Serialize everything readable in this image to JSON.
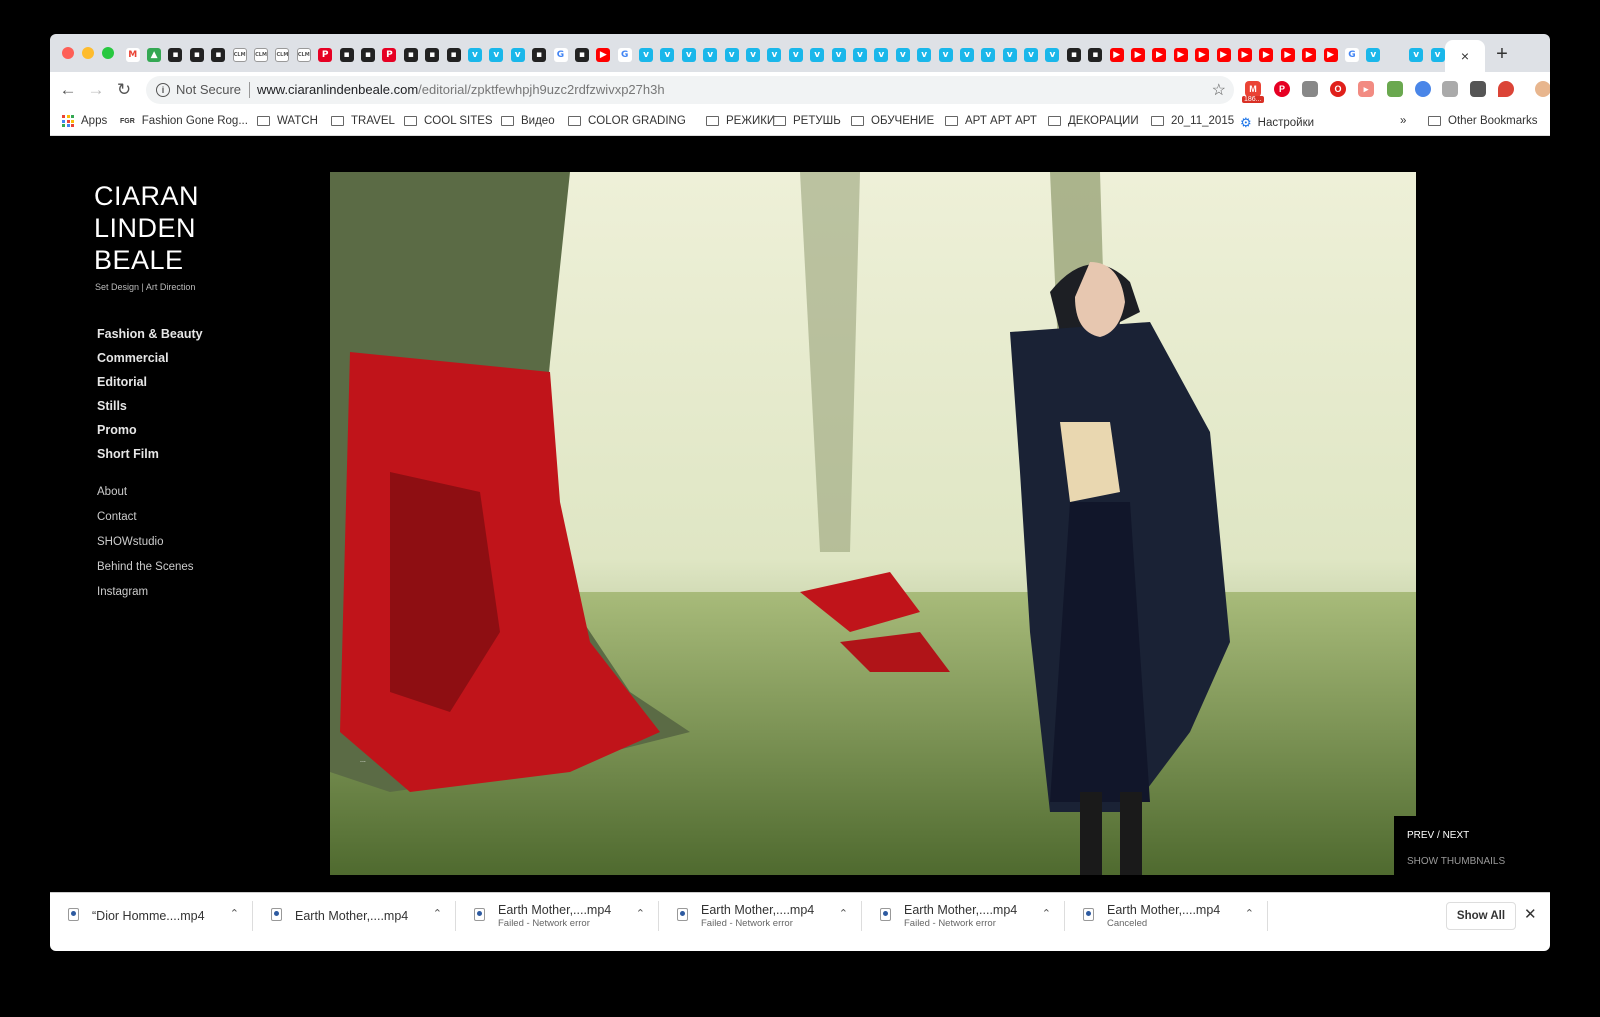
{
  "browser": {
    "tabs_favicons": [
      "gmail-icon",
      "drive-icon",
      "site-icon",
      "site-icon",
      "site-icon",
      "clm-icon",
      "clm-icon",
      "clm-icon",
      "clm-icon",
      "pinterest-icon",
      "site-icon",
      "site-icon",
      "pinterest-icon",
      "site-icon",
      "site-icon",
      "site-icon",
      "vimeo-icon",
      "vimeo-icon",
      "vimeo-icon",
      "site-icon",
      "google-icon",
      "site-icon",
      "youtube-icon",
      "google-icon",
      "vimeo-icon",
      "vimeo-icon",
      "vimeo-icon",
      "vimeo-icon",
      "vimeo-icon",
      "vimeo-icon",
      "vimeo-icon",
      "vimeo-icon",
      "vimeo-icon",
      "vimeo-icon",
      "vimeo-icon",
      "vimeo-icon",
      "vimeo-icon",
      "vimeo-icon",
      "vimeo-icon",
      "vimeo-icon",
      "vimeo-icon",
      "vimeo-icon",
      "vimeo-icon",
      "vimeo-icon",
      "site-icon",
      "site-icon",
      "youtube-icon",
      "youtube-icon",
      "youtube-icon",
      "youtube-icon",
      "youtube-icon",
      "youtube-icon",
      "youtube-icon",
      "youtube-icon",
      "youtube-icon",
      "youtube-icon",
      "youtube-icon",
      "google-icon",
      "vimeo-icon",
      "blank",
      "vimeo-icon",
      "vimeo-icon"
    ],
    "tab_close": "×",
    "new_tab": "+",
    "security_label": "Not Secure",
    "url_host": "www.ciaranlindenbeale.com",
    "url_path": "/editorial/zpktfewhpjh9uzc2rdfzwivxp27h3h",
    "ext_badge": "186...",
    "bookmarks": [
      {
        "label": "Apps",
        "icon": "apps-icon"
      },
      {
        "label": "Fashion Gone Rog...",
        "icon": "fgr-icon"
      },
      {
        "label": "WATCH",
        "icon": "folder-icon"
      },
      {
        "label": "TRAVEL",
        "icon": "folder-icon"
      },
      {
        "label": "COOL SITES",
        "icon": "folder-icon"
      },
      {
        "label": "Видео",
        "icon": "folder-icon"
      },
      {
        "label": "COLOR GRADING",
        "icon": "folder-icon"
      },
      {
        "label": "РЕЖИКИ",
        "icon": "folder-icon"
      },
      {
        "label": "РЕТУШЬ",
        "icon": "folder-icon"
      },
      {
        "label": "ОБУЧЕНИЕ",
        "icon": "folder-icon"
      },
      {
        "label": "АРТ АРТ АРТ",
        "icon": "folder-icon"
      },
      {
        "label": "ДЕКОРАЦИИ",
        "icon": "folder-icon"
      },
      {
        "label": "20_11_2015",
        "icon": "folder-icon"
      },
      {
        "label": "Настройки",
        "icon": "gear-icon"
      }
    ],
    "bookmarks_overflow": "»",
    "other_bookmarks": "Other Bookmarks"
  },
  "site": {
    "logo_lines": [
      "CIARAN",
      "LINDEN",
      "BEALE"
    ],
    "tagline": "Set Design | Art Direction",
    "nav_primary": [
      "Fashion & Beauty",
      "Commercial",
      "Editorial",
      "Stills",
      "Promo",
      "Short Film"
    ],
    "nav_secondary": [
      "About",
      "Contact",
      "SHOWstudio",
      "Behind the Scenes",
      "Instagram"
    ],
    "prev_next": "PREV / NEXT",
    "show_thumbnails": "SHOW THUMBNAILS"
  },
  "downloads": [
    {
      "name": "“Dior Homme....mp4",
      "status": ""
    },
    {
      "name": "Earth Mother,....mp4",
      "status": ""
    },
    {
      "name": "Earth Mother,....mp4",
      "status": "Failed - Network error"
    },
    {
      "name": "Earth Mother,....mp4",
      "status": "Failed - Network error"
    },
    {
      "name": "Earth Mother,....mp4",
      "status": "Failed - Network error"
    },
    {
      "name": "Earth Mother,....mp4",
      "status": "Canceled"
    }
  ],
  "show_all": "Show All",
  "colors": {
    "vimeo": "#1ab7ea",
    "youtube": "#ff0000",
    "pinterest": "#e60023",
    "gmail": "#ea4335"
  }
}
